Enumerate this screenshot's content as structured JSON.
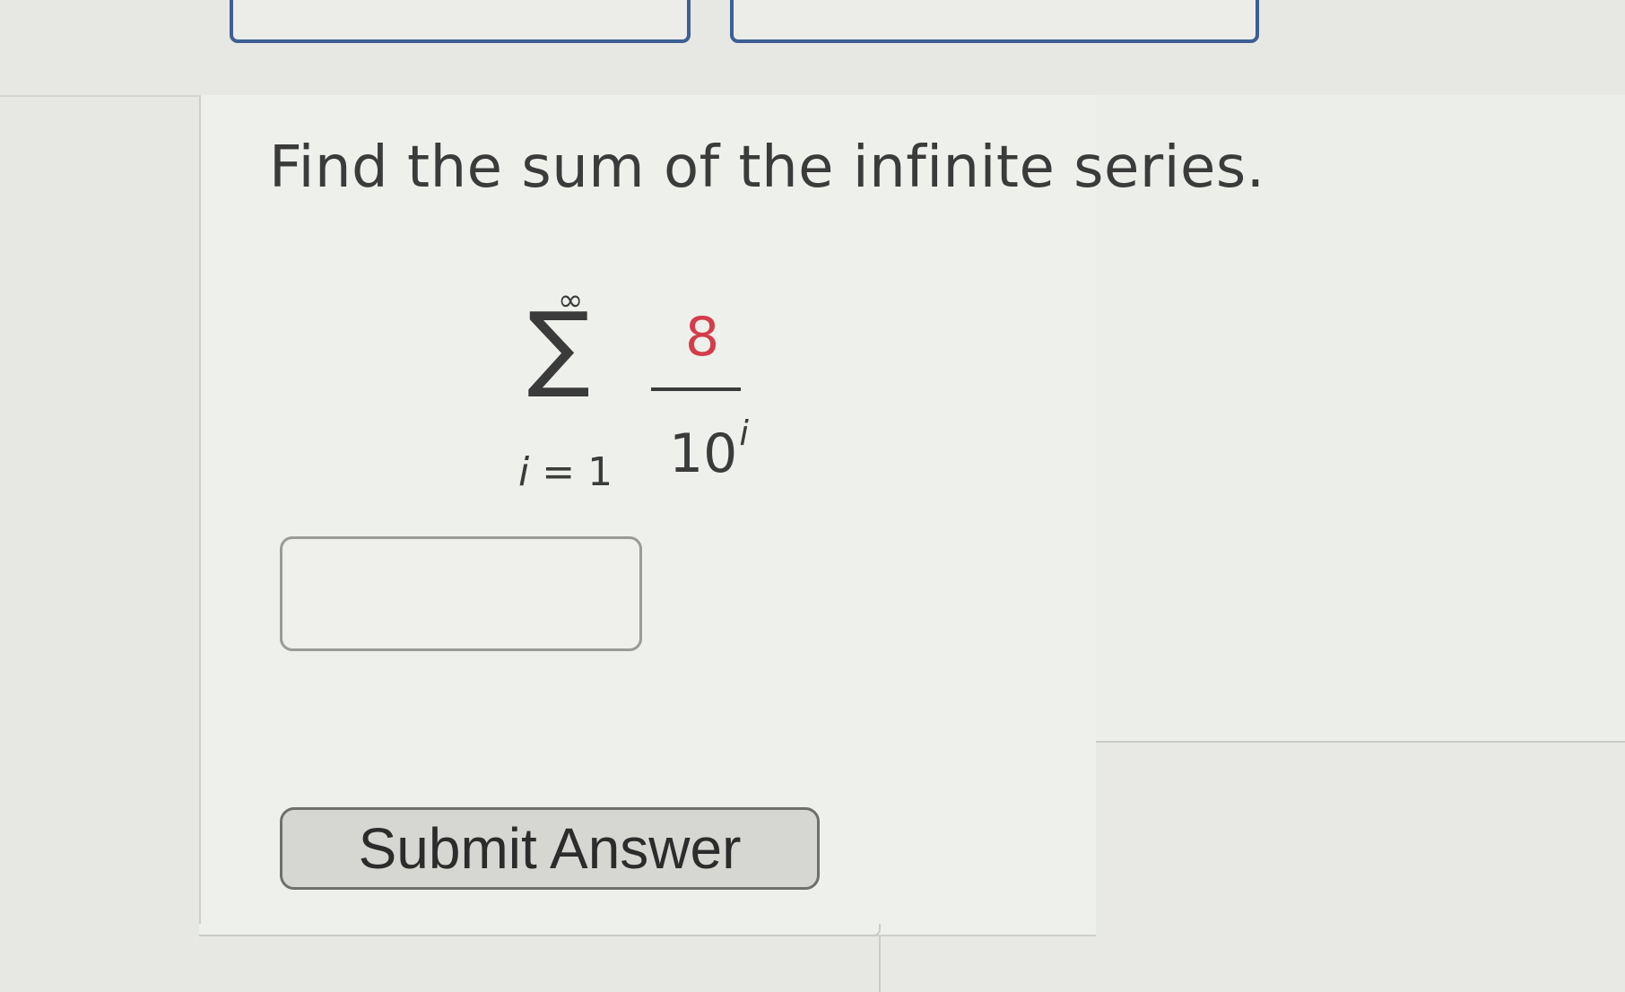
{
  "question": {
    "prompt": "Find the sum of the infinite series."
  },
  "formula": {
    "upper_limit": "∞",
    "sigma": "∑",
    "index_variable": "i",
    "index_equals": "= 1",
    "numerator": "8",
    "denominator_base": "10",
    "denominator_exponent": "i",
    "numerator_color": "#d43c4b"
  },
  "answer": {
    "value": "",
    "placeholder": ""
  },
  "actions": {
    "submit_label": "Submit Answer"
  }
}
